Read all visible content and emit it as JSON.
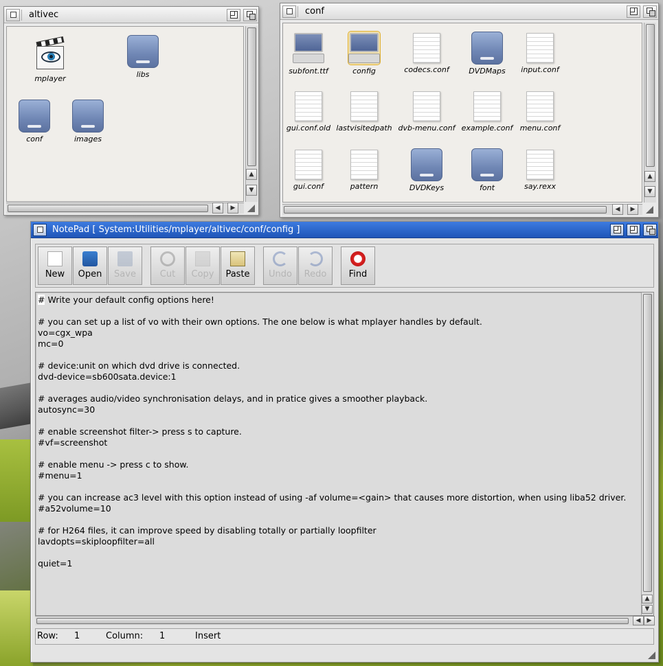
{
  "windows": {
    "altivec": {
      "title": "altivec",
      "icons": [
        {
          "label": "mplayer",
          "icon": "movie-clapper-icon"
        },
        {
          "label": "libs",
          "icon": "drawer-icon"
        },
        {
          "label": "conf",
          "icon": "drawer-icon"
        },
        {
          "label": "images",
          "icon": "drawer-icon"
        }
      ]
    },
    "conf": {
      "title": "conf",
      "icons": [
        {
          "label": "subfont.ttf",
          "icon": "computer-icon"
        },
        {
          "label": "config",
          "icon": "computer-icon"
        },
        {
          "label": "codecs.conf",
          "icon": "document-icon"
        },
        {
          "label": "DVDMaps",
          "icon": "drawer-icon"
        },
        {
          "label": "input.conf",
          "icon": "document-icon"
        },
        {
          "label": "gui.conf.old",
          "icon": "document-icon"
        },
        {
          "label": "lastvisitedpath",
          "icon": "document-icon"
        },
        {
          "label": "dvb-menu.conf",
          "icon": "document-icon"
        },
        {
          "label": "example.conf",
          "icon": "document-icon"
        },
        {
          "label": "menu.conf",
          "icon": "document-icon"
        },
        {
          "label": "gui.conf",
          "icon": "document-icon"
        },
        {
          "label": "pattern",
          "icon": "document-icon"
        },
        {
          "label": "DVDKeys",
          "icon": "drawer-icon"
        },
        {
          "label": "font",
          "icon": "drawer-icon"
        },
        {
          "label": "say.rexx",
          "icon": "document-icon"
        }
      ]
    },
    "notepad": {
      "title": "NotePad [ System:Utilities/mplayer/altivec/conf/config ]",
      "toolbar": {
        "new": "New",
        "open": "Open",
        "save": "Save",
        "cut": "Cut",
        "copy": "Copy",
        "paste": "Paste",
        "undo": "Undo",
        "redo": "Redo",
        "find": "Find"
      },
      "editor": {
        "first_char": "#",
        "text_rest": " Write your default config options here!\n\n# you can set up a list of vo with their own options. The one below is what mplayer handles by default.\nvo=cgx_wpa\nmc=0\n\n# device:unit on which dvd drive is connected.\ndvd-device=sb600sata.device:1\n\n# averages audio/video synchronisation delays, and in pratice gives a smoother playback.\nautosync=30\n\n# enable screenshot filter-> press s to capture.\n#vf=screenshot\n\n# enable menu -> press c to show.\n#menu=1\n\n# you can increase ac3 level with this option instead of using -af volume=<gain> that causes more distortion, when using liba52 driver.\n#a52volume=10\n\n# for H264 files, it can improve speed by disabling totally or partially loopfilter\nlavdopts=skiploopfilter=all\n\nquiet=1"
      },
      "status": {
        "row_label": "Row:",
        "row_value": "1",
        "col_label": "Column:",
        "col_value": "1",
        "mode": "Insert"
      }
    }
  }
}
